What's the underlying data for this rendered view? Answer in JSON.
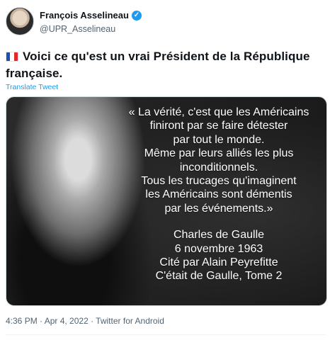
{
  "author": {
    "name": "François Asselineau",
    "handle": "@UPR_Asselineau",
    "verified": true
  },
  "tweet": {
    "flag_icon": "france-flag-icon",
    "text": "Voici ce qu'est un vrai Président de la République française.",
    "translate_label": "Translate Tweet"
  },
  "media": {
    "quote_lines": [
      "« La vérité, c'est que les Américains",
      "finiront par se faire détester",
      "par tout le monde.",
      "Même par leurs alliés les plus",
      "inconditionnels.",
      "Tous les trucages qu'imaginent",
      "les Américains sont démentis",
      "par les événements.»"
    ],
    "attribution_lines": [
      "Charles de Gaulle",
      "6 novembre 1963",
      "Cité par Alain Peyrefitte",
      "C'était de Gaulle, Tome 2"
    ]
  },
  "meta": {
    "timestamp": "4:36 PM · Apr 4, 2022 · Twitter for Android"
  },
  "colors": {
    "accent": "#1d9bf0",
    "secondary_text": "#536471"
  }
}
